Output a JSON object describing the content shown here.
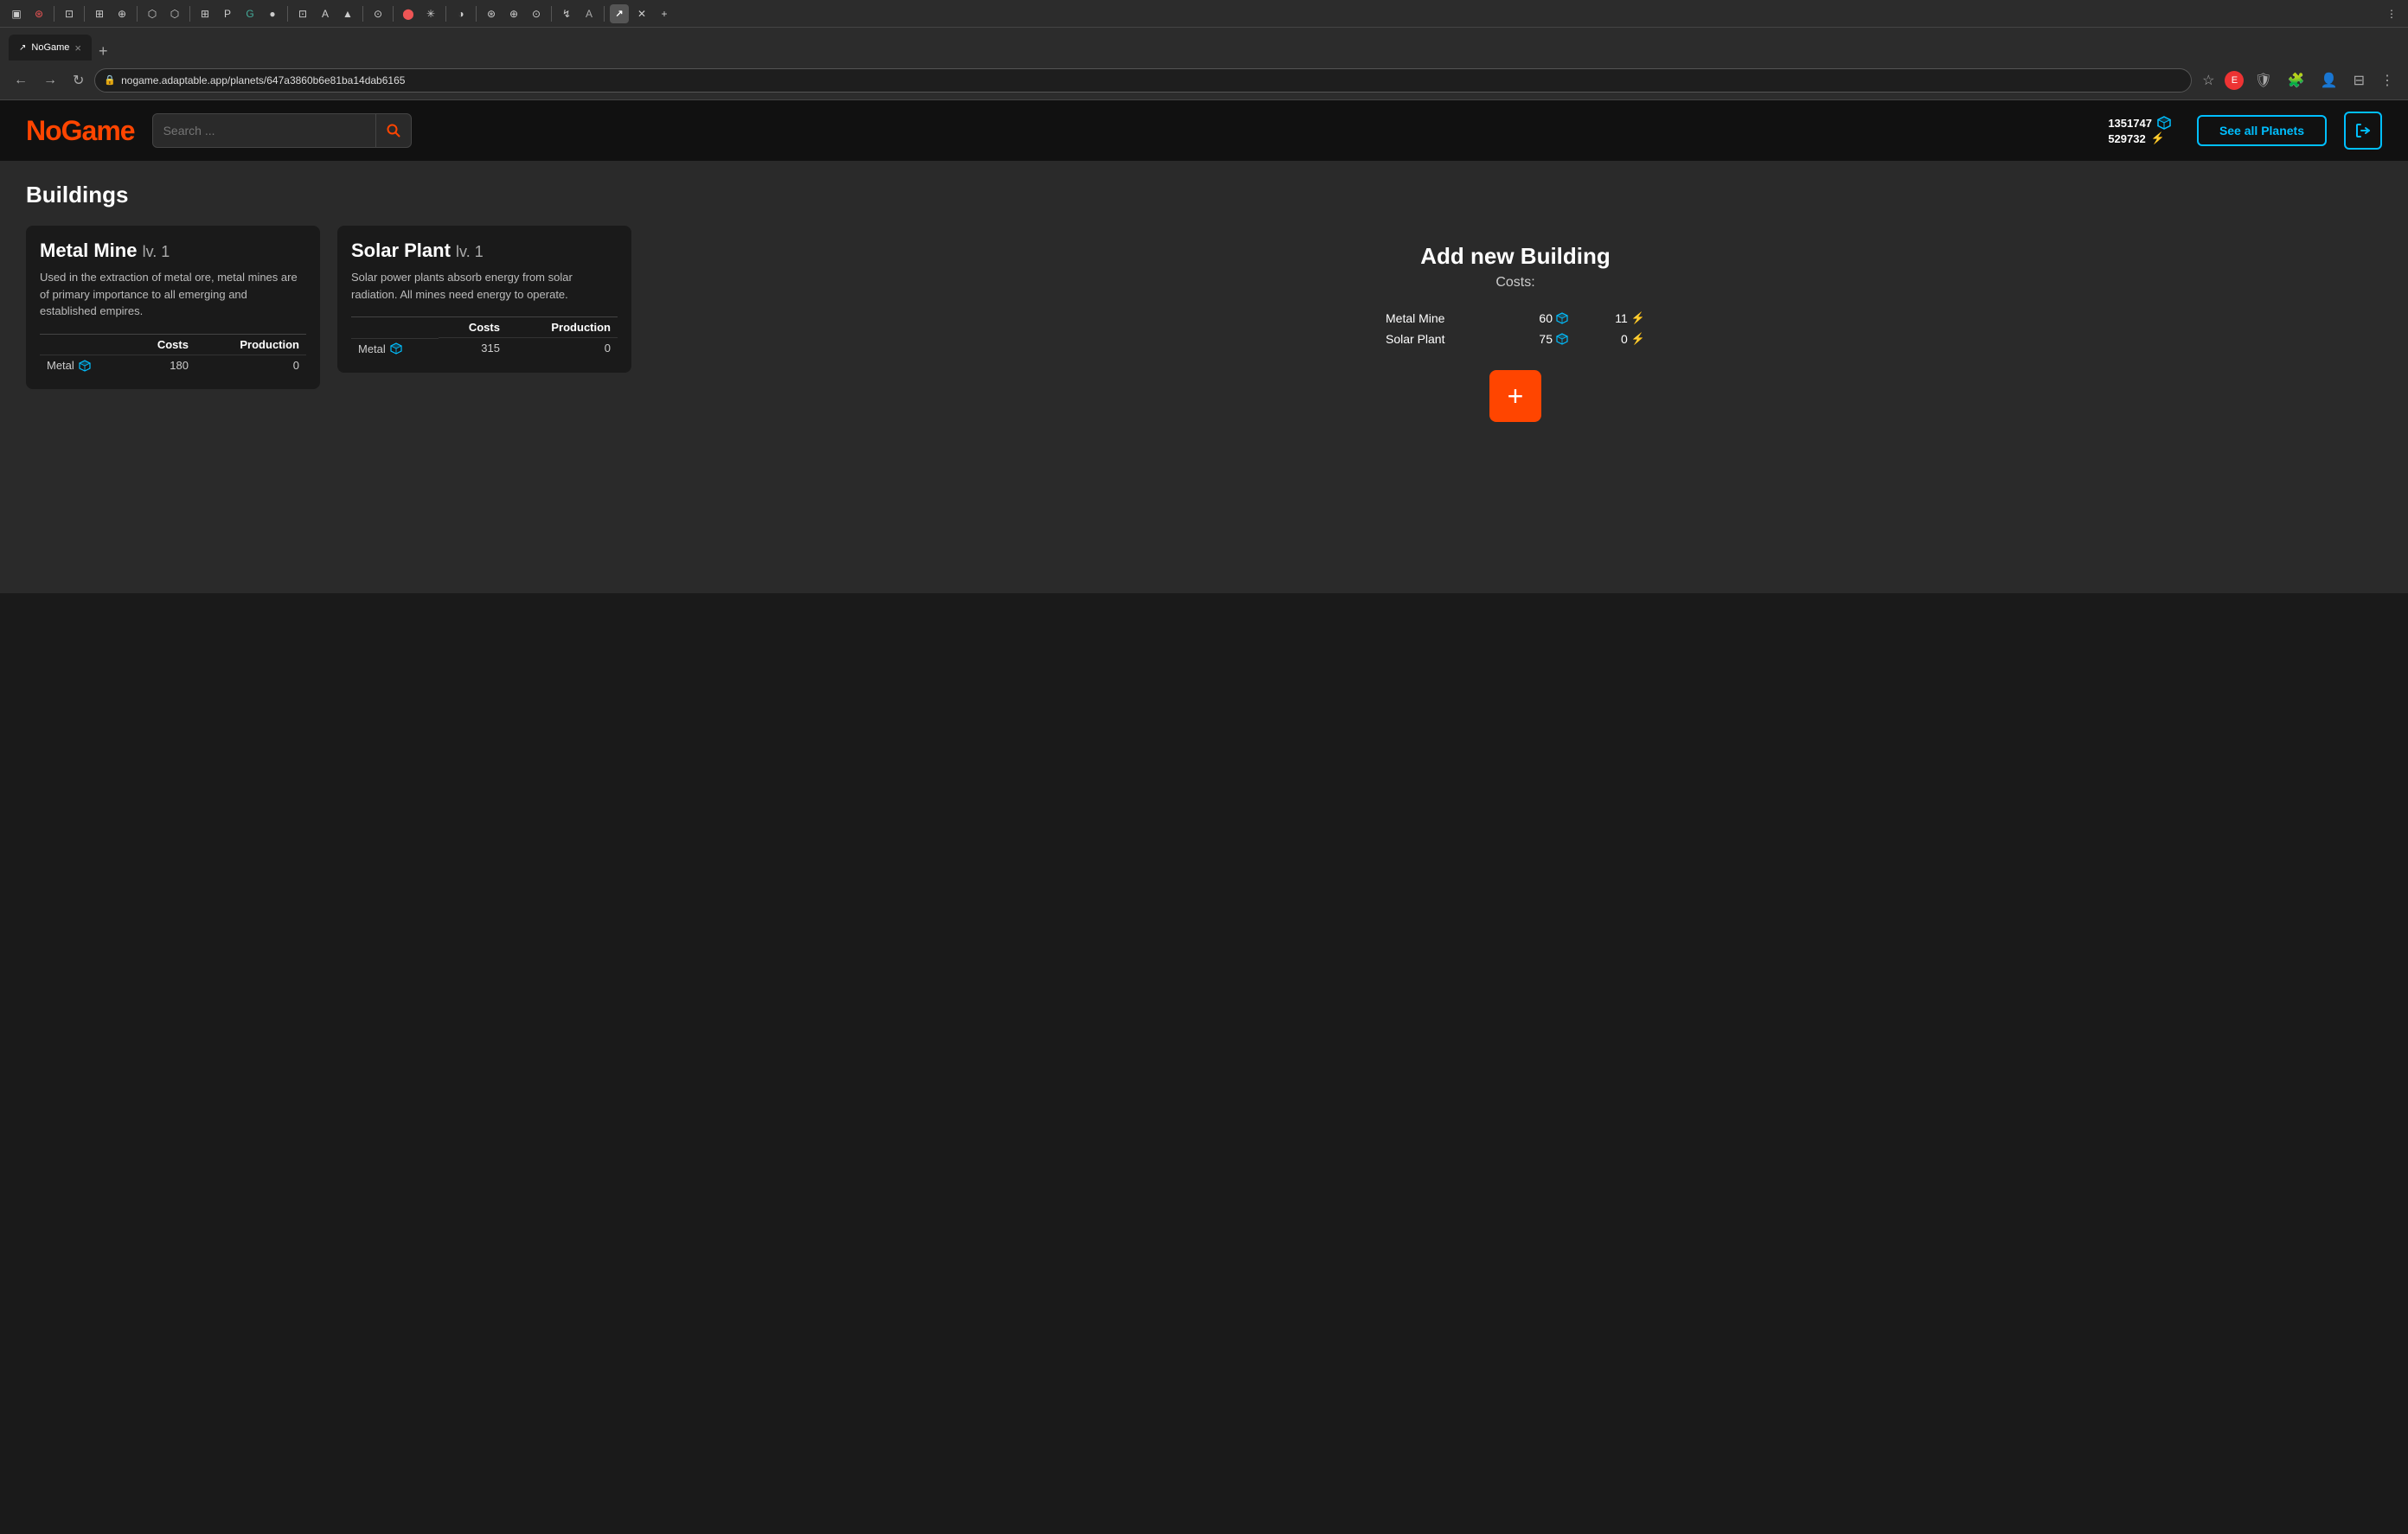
{
  "browser": {
    "url": "nogame.adaptable.app/planets/647a3860b6e81ba14dab6165",
    "tab_title": "NoGame",
    "tab_close": "×",
    "tab_add": "+"
  },
  "header": {
    "logo": "NoGame",
    "search_placeholder": "Search ...",
    "search_btn_label": "🔍",
    "stat_metal": "1351747",
    "stat_energy": "529732",
    "see_all_label": "See all Planets",
    "logout_icon": "→"
  },
  "page": {
    "section_title": "Buildings"
  },
  "buildings": [
    {
      "name": "Metal Mine",
      "level": "lv. 1",
      "description": "Used in the extraction of metal ore, metal mines are of primary importance to all emerging and established empires.",
      "table_headers": [
        "",
        "Costs",
        "Production"
      ],
      "rows": [
        {
          "resource": "Metal",
          "costs": "180",
          "production": "0"
        }
      ],
      "color_bars": [
        "#ff0000",
        "#ffff00",
        "#00bfff"
      ]
    },
    {
      "name": "Solar Plant",
      "level": "lv. 1",
      "description": "Solar power plants absorb energy from solar radiation. All mines need energy to operate.",
      "table_headers": [
        "",
        "Costs",
        "Production"
      ],
      "rows": [
        {
          "resource": "Metal",
          "costs": "315",
          "production": "0"
        }
      ],
      "color_bars": [
        "#ff0000",
        "#ffff00",
        "#00bfff"
      ]
    }
  ],
  "add_panel": {
    "title": "Add new Building",
    "subtitle": "Costs:",
    "items": [
      {
        "name": "Metal Mine",
        "metal_cost": "60",
        "energy_cost": "11"
      },
      {
        "name": "Solar Plant",
        "metal_cost": "75",
        "energy_cost": "0"
      }
    ],
    "add_btn_label": "+"
  }
}
